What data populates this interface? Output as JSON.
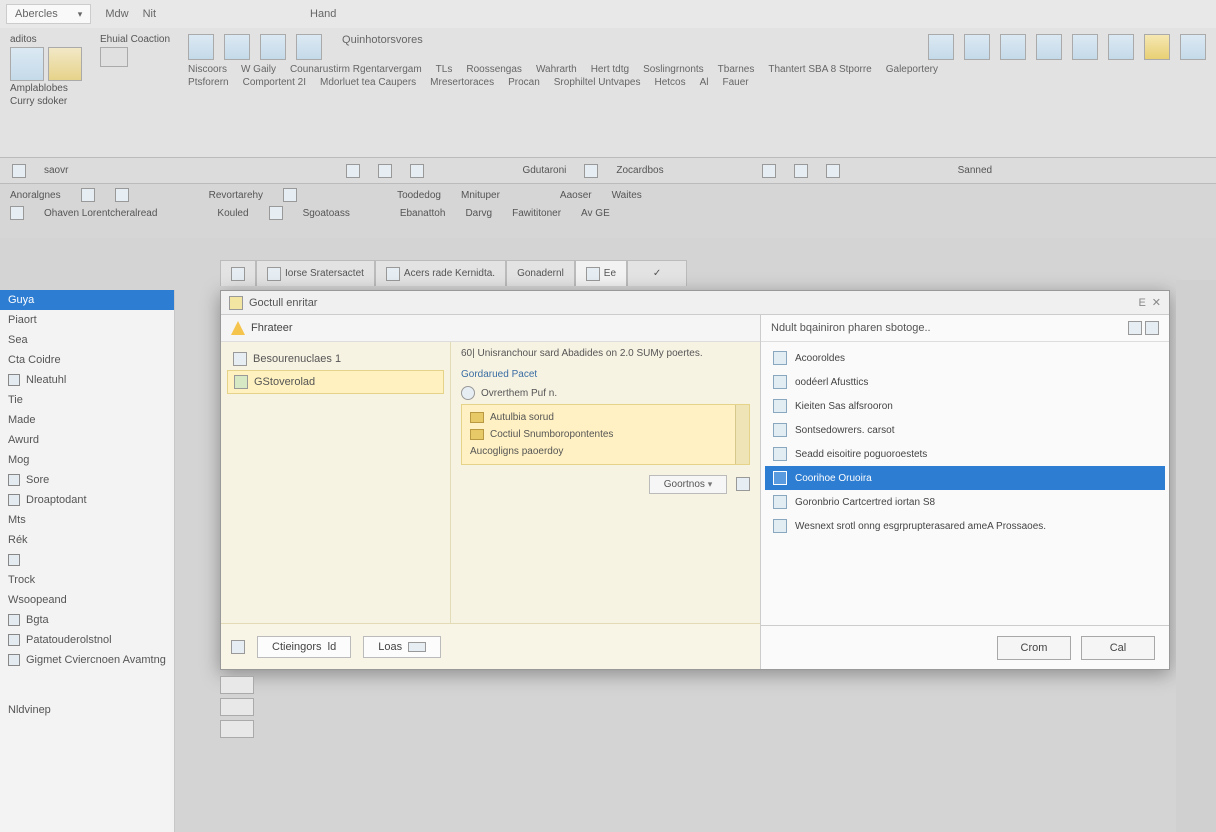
{
  "menubar": {
    "dropdown": "Abercles",
    "items": [
      "Mdw",
      "Nit",
      "Hand"
    ]
  },
  "ribbon": {
    "groups": {
      "g1": {
        "title": "aditos",
        "sub1": "Amplablobes",
        "sub2": "Curry sdoker"
      },
      "g2": {
        "title": "Ehuial Coaction"
      },
      "g3": {
        "title": "Quinhotorsvores"
      },
      "labels": [
        "Niscoors",
        "Ptsforern",
        "W Gaily",
        "Comportent 2I",
        "Counarustirm Rgentarvergam",
        "Mdorluet tea Caupers",
        "TLs",
        "Mresertoraces",
        "Roossengas",
        "Procan",
        "Srophiltel Untvapes",
        "Wahrarth",
        "Hert tdtg",
        "Hetcos",
        "Soslingrnonts",
        "Tbarnes",
        "Thantert SBA 8 Stporre",
        "Al",
        "Galeportery",
        "Fauer"
      ],
      "row2": [
        "Gdutaroni",
        "Zocardbos",
        "Sanned"
      ]
    }
  },
  "toolbar2": [
    "saovr"
  ],
  "toolbar3": {
    "row1": [
      "Anoralgnes",
      "Revortarehy",
      "Toodedog",
      "Mnituper",
      "Aaoser",
      "Waites"
    ],
    "row2": [
      "Ohaven Lorentcheralread",
      "Kouled",
      "Sgoatoass",
      "Ebanattoh",
      "Darvg",
      "Fawititoner",
      "Av GE"
    ]
  },
  "sidebar": {
    "header": "Guya",
    "items": [
      "Piaort",
      "Sea",
      "Cta Coidre",
      "Nleatuhl",
      "Tie",
      "Made",
      "Awurd",
      "Mog",
      "Sore",
      "Droaptodant",
      "Mts",
      "Rék",
      "Trock",
      "Wsoopeand",
      "Bgta",
      "Patatouderolstnol",
      "Gigmet Cviercnoen Avamtng",
      "Nldvinep"
    ]
  },
  "tabs": [
    "Iorse Sratersactet",
    "Acers rade Kernidta.",
    "Gonadernl",
    "Ee"
  ],
  "dialog": {
    "title": "Goctull enritar",
    "left": {
      "bartitle": "Fhrateer",
      "tree": [
        {
          "label": "Besourenuclaes 1"
        },
        {
          "label": "GStoverolad",
          "sel": true
        }
      ],
      "desc_prefix": "60|",
      "desc": "Unisranchour sard Abadides on 2.0 SUMy poertes.",
      "panel_hdr": "Gordarued Pacet",
      "sub_hdr": "Ovrerthem Puf n.",
      "items": [
        "Autulbia sorud",
        "Coctiul Snumboropontentes",
        "Aucogligns paoerdoy"
      ],
      "btn_inline": "Goortnos",
      "footer": {
        "b1": "Ctieingors",
        "b1_suffix": "ld",
        "b2": "Loas"
      }
    },
    "right": {
      "hdr": "Ndult bqainiron pharen sbotoge..",
      "options": [
        "Acooroldes",
        "oodéerl Afusttics",
        "Kieiten Sas alfsrooron",
        "Sontsedowrers. carsot",
        "Seadd eisoitire poguoroestets",
        "Coorihoe Oruoira",
        "Goronbrio Cartcertred iortan S8",
        "Wesnext srotl onng esgrprupterasared ameA Prossaoes."
      ],
      "sel_index": 5,
      "footer": {
        "ok": "Crom",
        "cancel": "Cal"
      }
    }
  }
}
